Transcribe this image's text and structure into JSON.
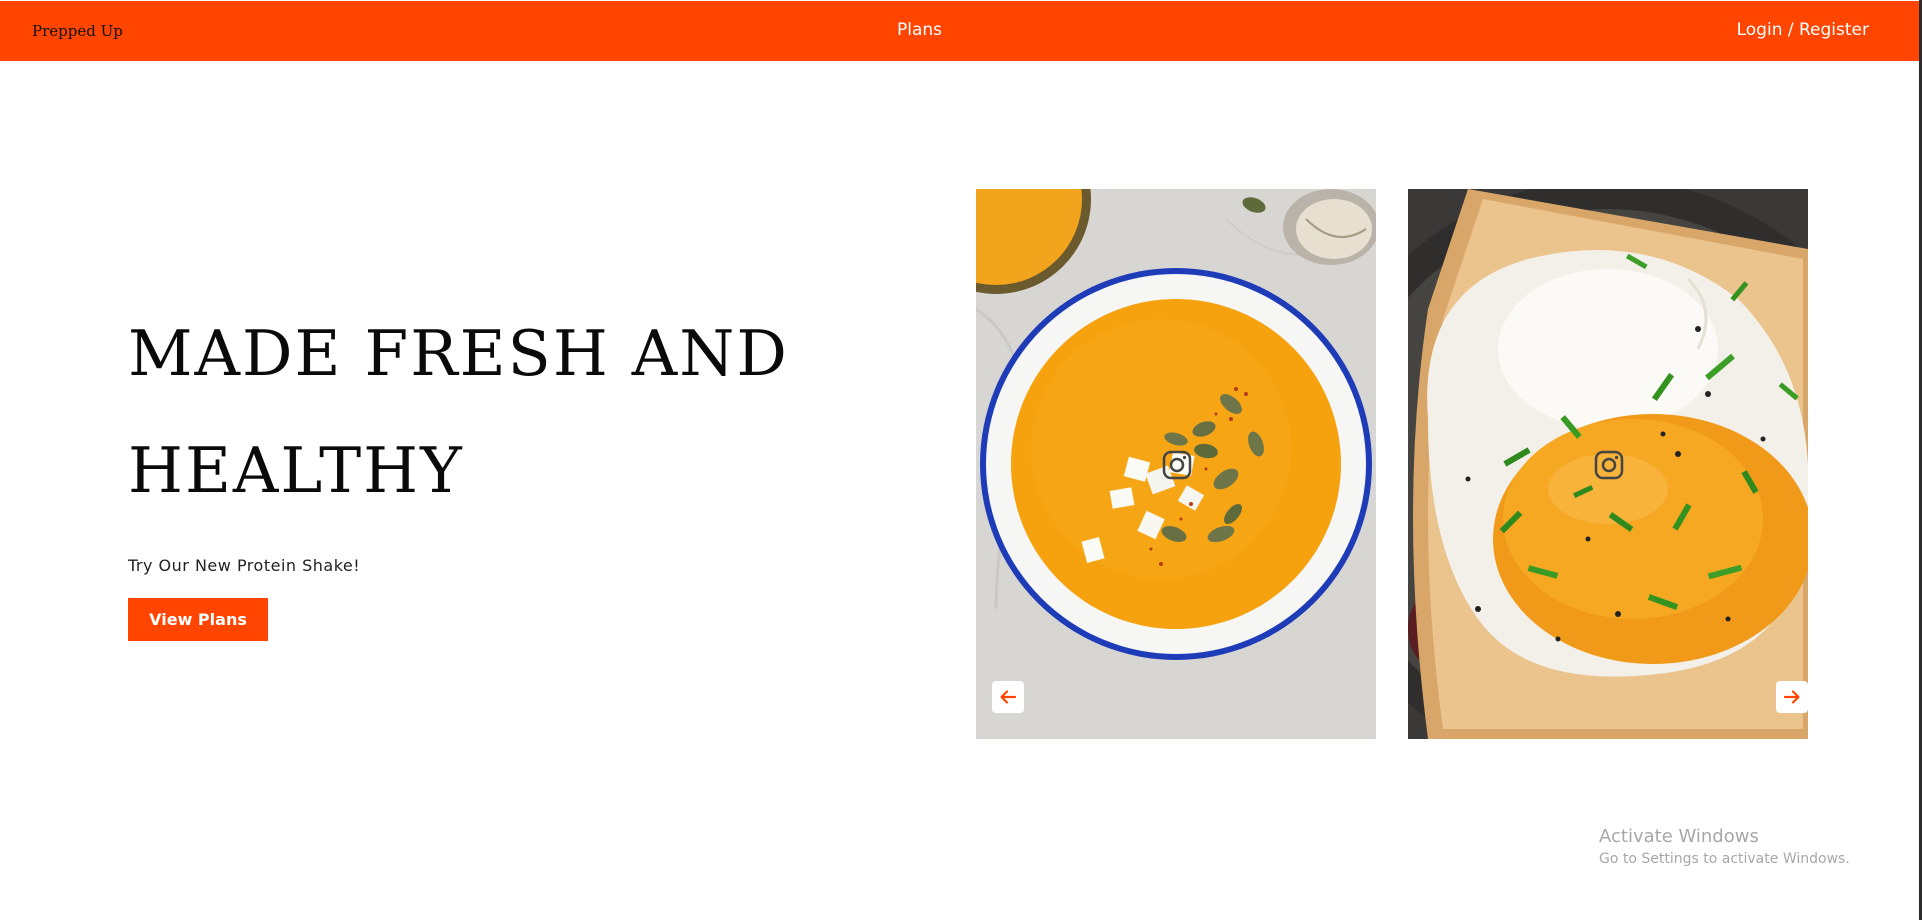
{
  "nav": {
    "brand": "Prepped Up",
    "plans_link": "Plans",
    "login_link": "Login / Register",
    "background_color": "#ff4500"
  },
  "hero": {
    "title": "MADE FRESH AND HEALTHY",
    "subtitle": "Try Our New Protein Shake!",
    "button_label": "View Plans",
    "accent_color": "#ff4500"
  },
  "carousel": {
    "slides": [
      {
        "image": "pumpkin-soup-bowl",
        "overlay_icon": "instagram-icon"
      },
      {
        "image": "fried-egg-toast",
        "overlay_icon": "instagram-icon"
      }
    ],
    "prev_icon": "arrow-left-icon",
    "next_icon": "arrow-right-icon"
  },
  "watermark": {
    "title": "Activate Windows",
    "subtitle": "Go to Settings to activate Windows."
  }
}
